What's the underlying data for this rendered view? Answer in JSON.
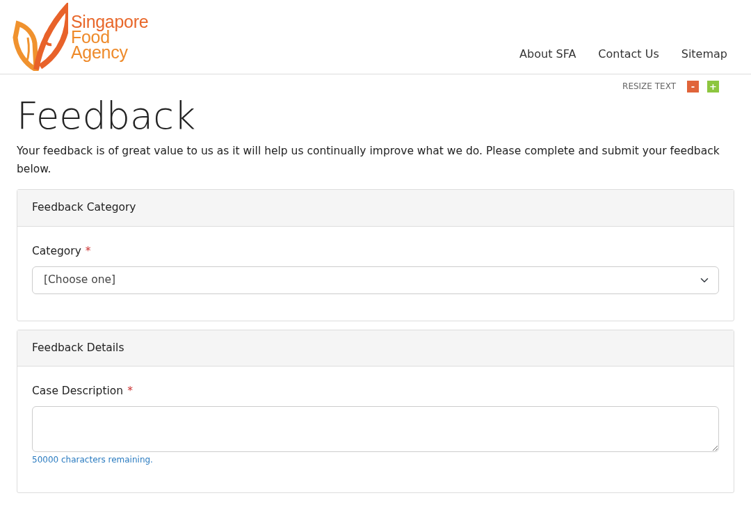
{
  "logo": {
    "lines": [
      "Singapore",
      "Food",
      "Agency"
    ]
  },
  "nav": [
    {
      "label": "About SFA"
    },
    {
      "label": "Contact Us"
    },
    {
      "label": "Sitemap"
    }
  ],
  "resize": {
    "label": "RESIZE TEXT",
    "decrease": "-",
    "increase": "+"
  },
  "title": "Feedback",
  "intro": "Your feedback is of great value to us as it will help us continually improve what we do. Please complete and submit your feedback below.",
  "sections": [
    {
      "heading": "Feedback Category",
      "fields": [
        {
          "kind": "select",
          "label": "Category",
          "required_mark": "*",
          "value": "[Choose one]"
        }
      ]
    },
    {
      "heading": "Feedback Details",
      "fields": [
        {
          "kind": "textarea",
          "label": "Case Description",
          "required_mark": "*",
          "counter": "50000 characters remaining."
        }
      ]
    }
  ]
}
